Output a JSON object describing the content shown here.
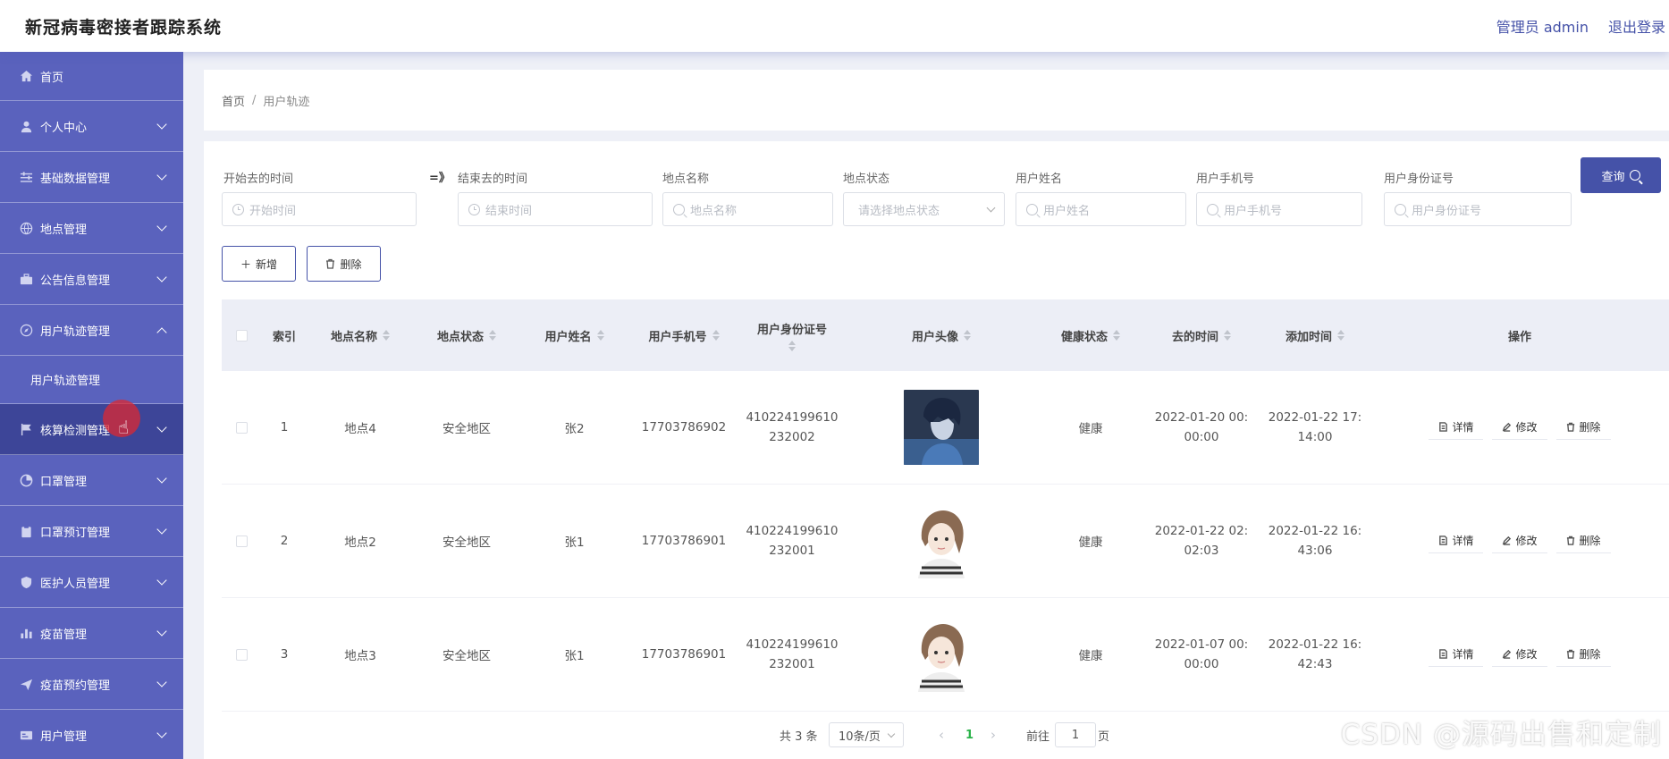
{
  "header": {
    "title": "新冠病毒密接者跟踪系统",
    "admin": "管理员 admin",
    "logout": "退出登录"
  },
  "sidebar": {
    "items": [
      {
        "label": "首页",
        "icon": "home-icon"
      },
      {
        "label": "个人中心",
        "icon": "user-icon"
      },
      {
        "label": "基础数据管理",
        "icon": "sliders-icon"
      },
      {
        "label": "地点管理",
        "icon": "globe-icon"
      },
      {
        "label": "公告信息管理",
        "icon": "briefcase-icon"
      },
      {
        "label": "用户轨迹管理",
        "icon": "compass-icon",
        "sub": "用户轨迹管理"
      },
      {
        "label": "核算检测管理",
        "icon": "flag-icon"
      },
      {
        "label": "口罩管理",
        "icon": "circle-icon"
      },
      {
        "label": "口罩预订管理",
        "icon": "clipboard-icon"
      },
      {
        "label": "医护人员管理",
        "icon": "shield-icon"
      },
      {
        "label": "疫苗管理",
        "icon": "bar-chart-icon"
      },
      {
        "label": "疫苗预约管理",
        "icon": "send-icon"
      },
      {
        "label": "用户管理",
        "icon": "card-icon"
      }
    ]
  },
  "breadcrumb": {
    "home": "首页",
    "sep": "/",
    "current": "用户轨迹"
  },
  "filters": {
    "start_label": "开始去的时间",
    "start_ph": "开始时间",
    "arrow": "=》",
    "end_label": "结束去的时间",
    "end_ph": "结束时间",
    "place_label": "地点名称",
    "place_ph": "地点名称",
    "status_label": "地点状态",
    "status_ph": "请选择地点状态",
    "name_label": "用户姓名",
    "name_ph": "用户姓名",
    "phone_label": "用户手机号",
    "phone_ph": "用户手机号",
    "id_label": "用户身份证号",
    "id_ph": "用户身份证号",
    "query": "查询"
  },
  "actions": {
    "add": "新增",
    "delete": "删除"
  },
  "table": {
    "headers": {
      "index": "索引",
      "place": "地点名称",
      "status": "地点状态",
      "name": "用户姓名",
      "phone": "用户手机号",
      "idno": "用户身份证号",
      "avatar": "用户头像",
      "health": "健康状态",
      "go_time": "去的时间",
      "add_time": "添加时间",
      "ops": "操作"
    },
    "rows": [
      {
        "index": "1",
        "place": "地点4",
        "status": "安全地区",
        "name": "张2",
        "phone": "17703786902",
        "id1": "410224199610",
        "id2": "232002",
        "health": "健康",
        "go1": "2022-01-20 00:",
        "go2": "00:00",
        "add1": "2022-01-22 17:",
        "add2": "14:00",
        "avatar": "boy"
      },
      {
        "index": "2",
        "place": "地点2",
        "status": "安全地区",
        "name": "张1",
        "phone": "17703786901",
        "id1": "410224199610",
        "id2": "232001",
        "health": "健康",
        "go1": "2022-01-22 02:",
        "go2": "02:03",
        "add1": "2022-01-22 16:",
        "add2": "43:06",
        "avatar": "girl"
      },
      {
        "index": "3",
        "place": "地点3",
        "status": "安全地区",
        "name": "张1",
        "phone": "17703786901",
        "id1": "410224199610",
        "id2": "232001",
        "health": "健康",
        "go1": "2022-01-07 00:",
        "go2": "00:00",
        "add1": "2022-01-22 16:",
        "add2": "42:43",
        "avatar": "girl"
      }
    ],
    "op_detail": "详情",
    "op_edit": "修改",
    "op_delete": "删除"
  },
  "pager": {
    "total": "共 3 条",
    "size": "10条/页",
    "page": "1",
    "goto": "前往",
    "goto_val": "1",
    "page_unit": "页"
  },
  "watermark": "CSDN @源码出售和定制"
}
